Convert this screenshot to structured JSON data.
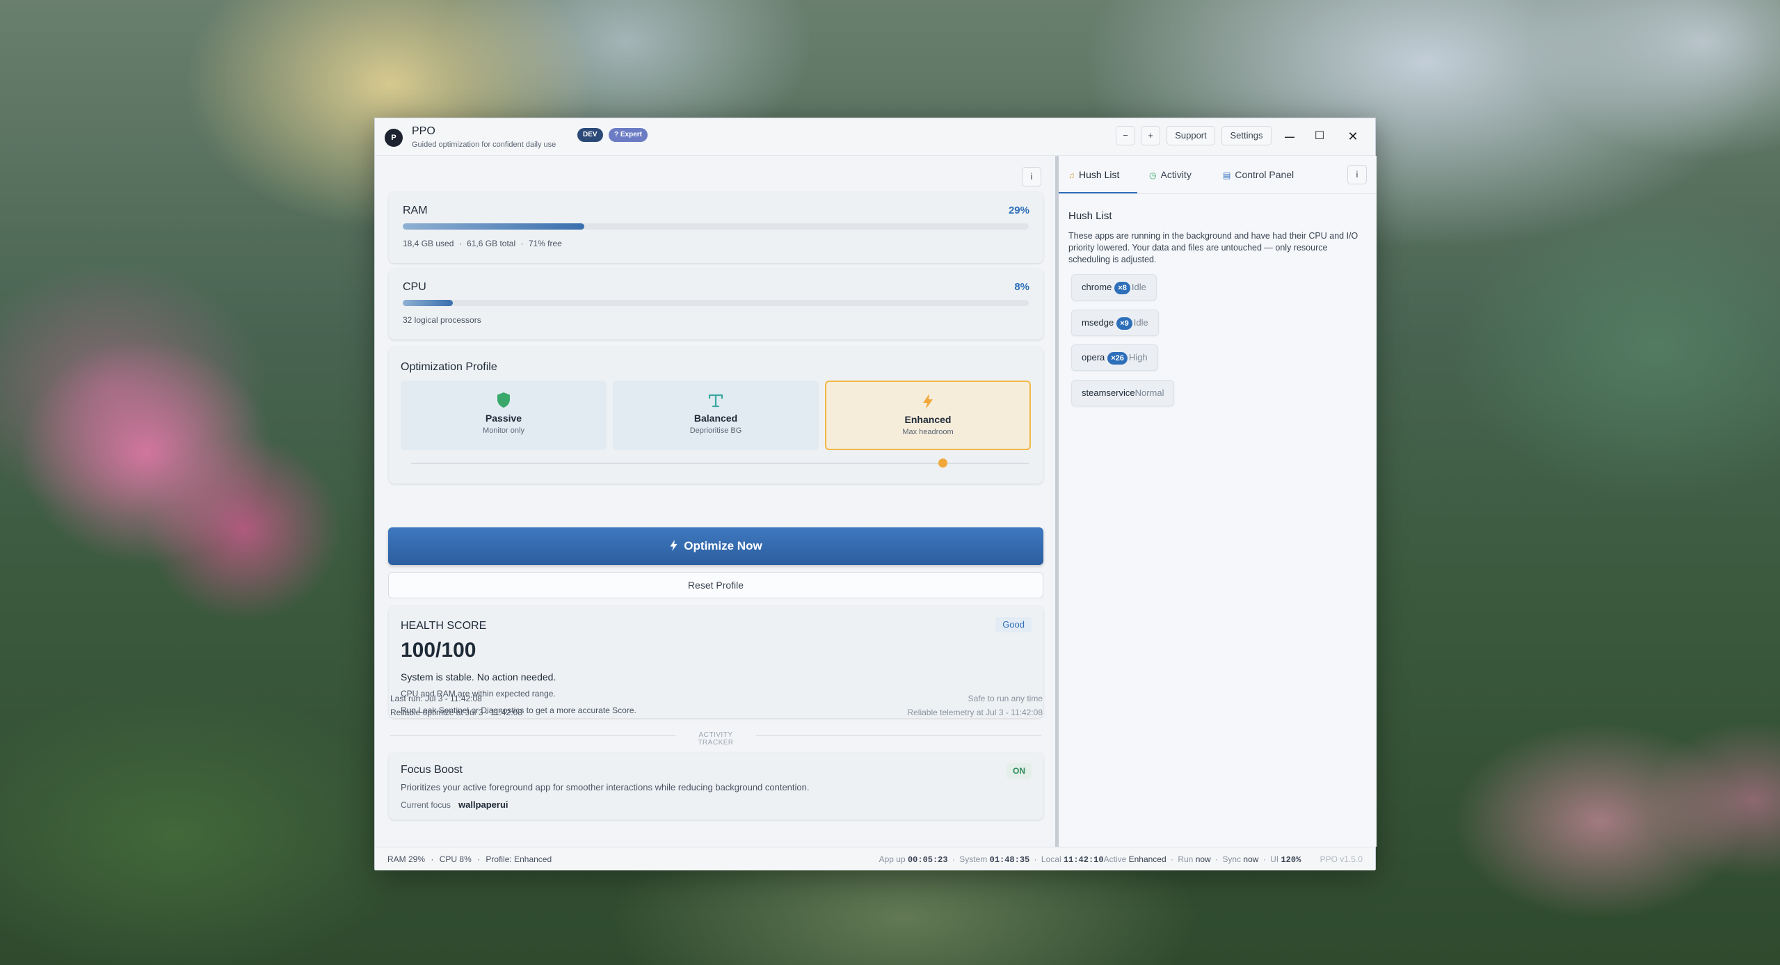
{
  "window": {
    "app_name": "PPO",
    "logo_letter": "P",
    "subtitle": "Guided optimization for confident daily use",
    "badge_dev": "DEV",
    "badge_expert": "? Expert",
    "zoom_out": "−",
    "zoom_in": "+",
    "support": "Support",
    "settings": "Settings",
    "minimize": "—",
    "maximize": "☐",
    "close": "✕"
  },
  "left": {
    "info": "i",
    "ram": {
      "label": "RAM",
      "percent": "29%",
      "fill": 0.29,
      "used": "18,4 GB used",
      "total": "61,6 GB total",
      "free": "71% free"
    },
    "cpu": {
      "label": "CPU",
      "percent": "8%",
      "fill": 0.08,
      "detail": "32 logical processors"
    },
    "profile": {
      "title": "Optimization Profile",
      "options": [
        {
          "name": "Passive",
          "desc": "Monitor only",
          "icon": "shield-icon"
        },
        {
          "name": "Balanced",
          "desc": "Deprioritise BG",
          "icon": "balance-icon"
        },
        {
          "name": "Enhanced",
          "desc": "Max headroom",
          "icon": "bolt-icon"
        }
      ],
      "selected": "Enhanced",
      "slider_level": 0.86
    },
    "optimize_label": "Optimize Now",
    "reset_label": "Reset Profile",
    "health": {
      "title": "HEALTH SCORE",
      "badge": "Good",
      "score": "100/100",
      "message": "System is stable. No action needed.",
      "line1": "CPU and RAM are within expected range.",
      "line2": "Run Leak Sentinel or Diagnostics to get a more accurate Score."
    },
    "meta": {
      "last_run": "Last run: Jul 3 - 11:42:08",
      "reliable_optimize": "Reliable optimize at Jul 3 - 11:42:08",
      "safe": "Safe to run any time",
      "reliable_telemetry": "Reliable telemetry at Jul 3 - 11:42:08"
    },
    "tracker_label": "ACTIVITY TRACKER",
    "focus": {
      "title": "Focus Boost",
      "state": "ON",
      "desc": "Prioritizes your active foreground app for smoother interactions while reducing background contention.",
      "current_label": "Current focus",
      "current_value": "wallpaperui"
    }
  },
  "right": {
    "tabs": [
      {
        "label": "Hush List",
        "icon": "hush-icon"
      },
      {
        "label": "Activity",
        "icon": "clock-icon"
      },
      {
        "label": "Control Panel",
        "icon": "monitor-icon"
      }
    ],
    "info": "i",
    "hush": {
      "title": "Hush List",
      "desc": "These apps are running in the background and have had their CPU and I/O priority lowered. Your data and files are untouched — only resource scheduling is adjusted.",
      "items": [
        {
          "name": "chrome",
          "count": "×8",
          "state": "Idle"
        },
        {
          "name": "msedge",
          "count": "×9",
          "state": "Idle"
        },
        {
          "name": "opera",
          "count": "×26",
          "state": "High"
        },
        {
          "name": "steamservice",
          "count": "",
          "state": "Normal"
        }
      ]
    }
  },
  "status": {
    "ram": "RAM 29%",
    "cpu": "CPU 8%",
    "profile": "Profile: Enhanced",
    "dot": "·",
    "app_up_label": "App up",
    "app_up": "00:05:23",
    "system_label": "System",
    "system": "01:48:35",
    "local_label": "Local",
    "local": "11:42:10",
    "active_label": "Active",
    "active": "Enhanced",
    "run_label": "Run",
    "run": "now",
    "sync_label": "Sync",
    "sync": "now",
    "ui_label": "UI",
    "ui": "120%",
    "version": "PPO v1.5.0"
  },
  "colors": {
    "accent": "#2e6fba",
    "enhanced": "#f0b845",
    "passive": "#3aa86b",
    "balanced": "#3aa8a0"
  }
}
